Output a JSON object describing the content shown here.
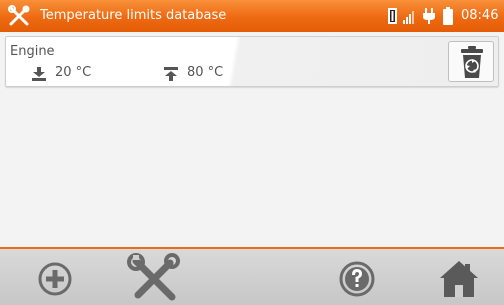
{
  "titlebar": {
    "title": "Temperature limits database",
    "clock": "08:46",
    "logo_icon": "tools-icon",
    "status_icons": [
      "memory-card-icon",
      "signal-strength-icon",
      "power-plug-icon",
      "battery-icon"
    ]
  },
  "records": [
    {
      "name": "Engine",
      "min_icon": "min-download-arrow-icon",
      "min_value": "20 °C",
      "max_icon": "max-upload-arrow-icon",
      "max_value": "80 °C",
      "delete_icon": "recycle-trash-icon"
    }
  ],
  "toolbar": {
    "buttons": [
      {
        "name": "add-button",
        "icon": "plus-circle-icon"
      },
      {
        "name": "settings-button",
        "icon": "tools-icon"
      },
      {
        "name": "help-button",
        "icon": "question-circle-icon"
      },
      {
        "name": "home-button",
        "icon": "home-icon"
      }
    ]
  },
  "colors": {
    "accent": "#ee6a12",
    "toolbar_icon": "#6a6a6a",
    "text": "#555555"
  }
}
